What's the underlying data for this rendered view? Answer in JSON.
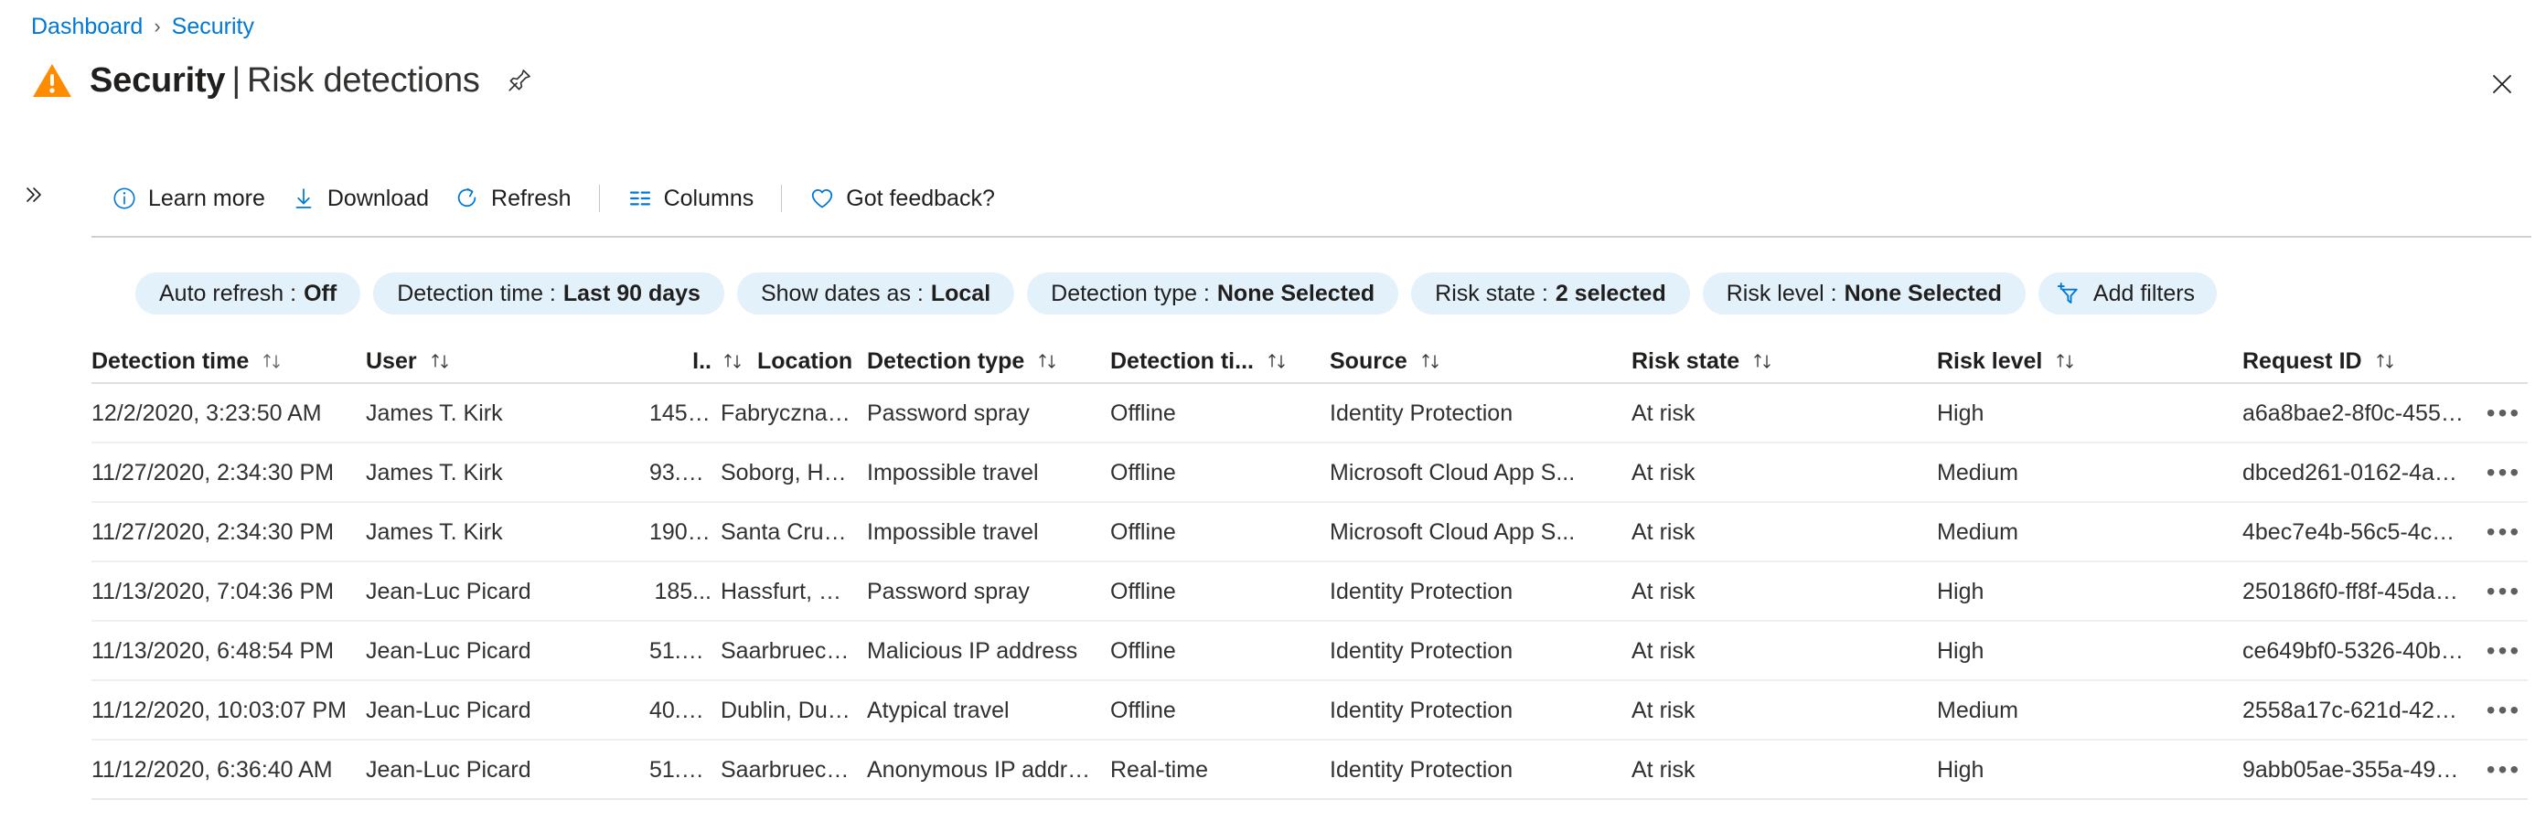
{
  "breadcrumb": {
    "items": [
      "Dashboard",
      "Security"
    ],
    "separator": "›"
  },
  "header": {
    "title_strong": "Security",
    "title_bar": "|",
    "title_light": "Risk detections",
    "warning_icon": "warning-triangle-icon",
    "pin_icon": "pin-icon",
    "close_icon": "close-icon"
  },
  "commandbar": {
    "expand_icon": "chevron-double-right-icon",
    "items": [
      {
        "label": "Learn more",
        "icon": "info-circle-icon"
      },
      {
        "label": "Download",
        "icon": "download-arrow-icon"
      },
      {
        "label": "Refresh",
        "icon": "refresh-icon"
      },
      {
        "label": "Columns",
        "icon": "columns-icon"
      },
      {
        "label": "Got feedback?",
        "icon": "heart-icon"
      }
    ]
  },
  "filters": {
    "pills": [
      {
        "key": "Auto refresh :",
        "value": "Off"
      },
      {
        "key": "Detection time :",
        "value": "Last 90 days"
      },
      {
        "key": "Show dates as :",
        "value": "Local"
      },
      {
        "key": "Detection type :",
        "value": "None Selected"
      },
      {
        "key": "Risk state :",
        "value": "2 selected"
      },
      {
        "key": "Risk level :",
        "value": "None Selected"
      }
    ],
    "add_filters": {
      "label": "Add filters",
      "icon": "add-filter-funnel-icon"
    }
  },
  "table": {
    "columns": [
      {
        "label": "Detection time",
        "sortable": true
      },
      {
        "label": "User",
        "sortable": true
      },
      {
        "label": "I..",
        "sortable": true
      },
      {
        "label": "Location",
        "sortable": false
      },
      {
        "label": "Detection type",
        "sortable": true
      },
      {
        "label": "Detection ti...",
        "sortable": true
      },
      {
        "label": "Source",
        "sortable": true
      },
      {
        "label": "Risk state",
        "sortable": true
      },
      {
        "label": "Risk level",
        "sortable": true
      },
      {
        "label": "Request ID",
        "sortable": true
      }
    ],
    "row_menu_label": "•••",
    "rows": [
      {
        "detection_time": "12/2/2020, 3:23:50 AM",
        "user": "James T. Kirk",
        "ip": "145....",
        "location": "Fabryczna, ...",
        "detection_type": "Password spray",
        "detection_timing": "Offline",
        "source": "Identity Protection",
        "risk_state": "At risk",
        "risk_level": "High",
        "request_id": "a6a8bae2-8f0c-4558-a..."
      },
      {
        "detection_time": "11/27/2020, 2:34:30 PM",
        "user": "James T. Kirk",
        "ip": "93.1...",
        "location": "Soborg, Ho...",
        "detection_type": "Impossible travel",
        "detection_timing": "Offline",
        "source": "Microsoft Cloud App S...",
        "risk_state": "At risk",
        "risk_level": "Medium",
        "request_id": "dbced261-0162-4a70-..."
      },
      {
        "detection_time": "11/27/2020, 2:34:30 PM",
        "user": "James T. Kirk",
        "ip": "190....",
        "location": "Santa Cruz ...",
        "detection_type": "Impossible travel",
        "detection_timing": "Offline",
        "source": "Microsoft Cloud App S...",
        "risk_state": "At risk",
        "risk_level": "Medium",
        "request_id": "4bec7e4b-56c5-4c7e-..."
      },
      {
        "detection_time": "11/13/2020, 7:04:36 PM",
        "user": "Jean-Luc Picard",
        "ip": "185...",
        "location": "Hassfurt, Ba...",
        "detection_type": "Password spray",
        "detection_timing": "Offline",
        "source": "Identity Protection",
        "risk_state": "At risk",
        "risk_level": "High",
        "request_id": "250186f0-ff8f-45da-9a..."
      },
      {
        "detection_time": "11/13/2020, 6:48:54 PM",
        "user": "Jean-Luc Picard",
        "ip": "51.7...",
        "location": "Saarbrueck...",
        "detection_type": "Malicious IP address",
        "detection_timing": "Offline",
        "source": "Identity Protection",
        "risk_state": "At risk",
        "risk_level": "High",
        "request_id": "ce649bf0-5326-40b8-..."
      },
      {
        "detection_time": "11/12/2020, 10:03:07 PM",
        "user": "Jean-Luc Picard",
        "ip": "40.1...",
        "location": "Dublin, Dub...",
        "detection_type": "Atypical travel",
        "detection_timing": "Offline",
        "source": "Identity Protection",
        "risk_state": "At risk",
        "risk_level": "Medium",
        "request_id": "2558a17c-621d-425f-..."
      },
      {
        "detection_time": "11/12/2020, 6:36:40 AM",
        "user": "Jean-Luc Picard",
        "ip": "51.7...",
        "location": "Saarbrueck...",
        "detection_type": "Anonymous IP address",
        "detection_timing": "Real-time",
        "source": "Identity Protection",
        "risk_state": "At risk",
        "risk_level": "High",
        "request_id": "9abb05ae-355a-4994-..."
      }
    ]
  },
  "colors": {
    "link": "#0078d4",
    "pill_bg": "#e3f1fb",
    "warning": "#ff8c00",
    "text": "#201f1e"
  }
}
